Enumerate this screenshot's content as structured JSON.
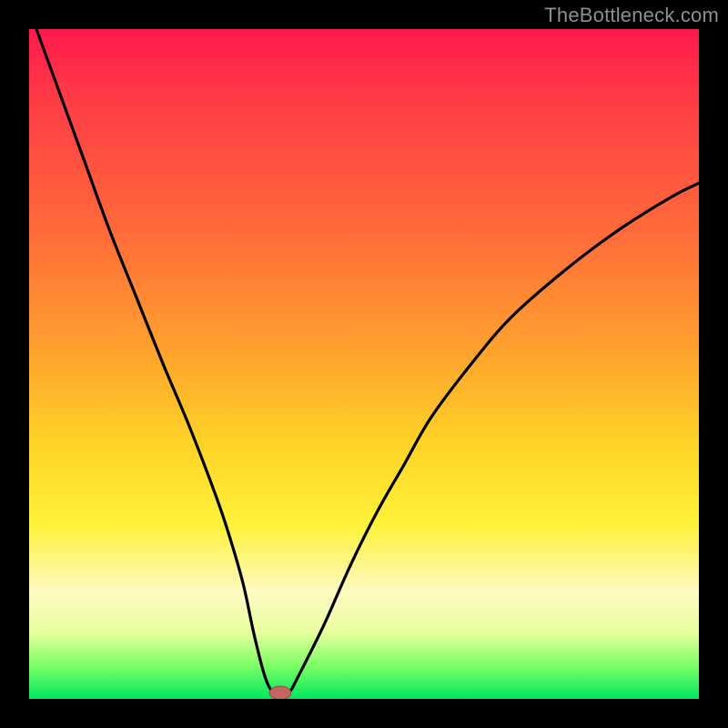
{
  "watermark": "TheBottleneck.com",
  "colors": {
    "frame": "#000000",
    "curve": "#000000",
    "marker_fill": "#c26660",
    "marker_stroke": "#9b4a44",
    "gradient_stops": [
      "#ff1a4d",
      "#ff3a47",
      "#ff6a3a",
      "#ffa22e",
      "#ffd427",
      "#fff23a",
      "#fffac2",
      "#e9ff9f",
      "#7dff66",
      "#00e85f"
    ]
  },
  "chart_data": {
    "type": "line",
    "title": "",
    "xlabel": "",
    "ylabel": "",
    "xlim": [
      0,
      100
    ],
    "ylim": [
      0,
      100
    ],
    "series": [
      {
        "name": "bottleneck-curve",
        "x": [
          0,
          4,
          8,
          12,
          16,
          20,
          24,
          28,
          30,
          32,
          33.5,
          35,
          36,
          37,
          38,
          39,
          40,
          44,
          48,
          52,
          56,
          60,
          66,
          72,
          80,
          88,
          96,
          100
        ],
        "y": [
          103,
          92,
          81,
          70,
          60,
          50,
          40.5,
          30,
          24,
          17,
          10,
          4,
          1.5,
          0.8,
          0.8,
          1.2,
          3,
          11,
          20,
          28,
          35,
          42,
          50,
          57,
          64,
          70,
          75,
          77
        ]
      }
    ],
    "marker": {
      "x": 37.5,
      "y": 0.9,
      "rx": 1.6,
      "ry": 1.0
    },
    "flat_bottom": {
      "x_start": 35.5,
      "x_end": 39.0,
      "y": 0.8
    }
  }
}
